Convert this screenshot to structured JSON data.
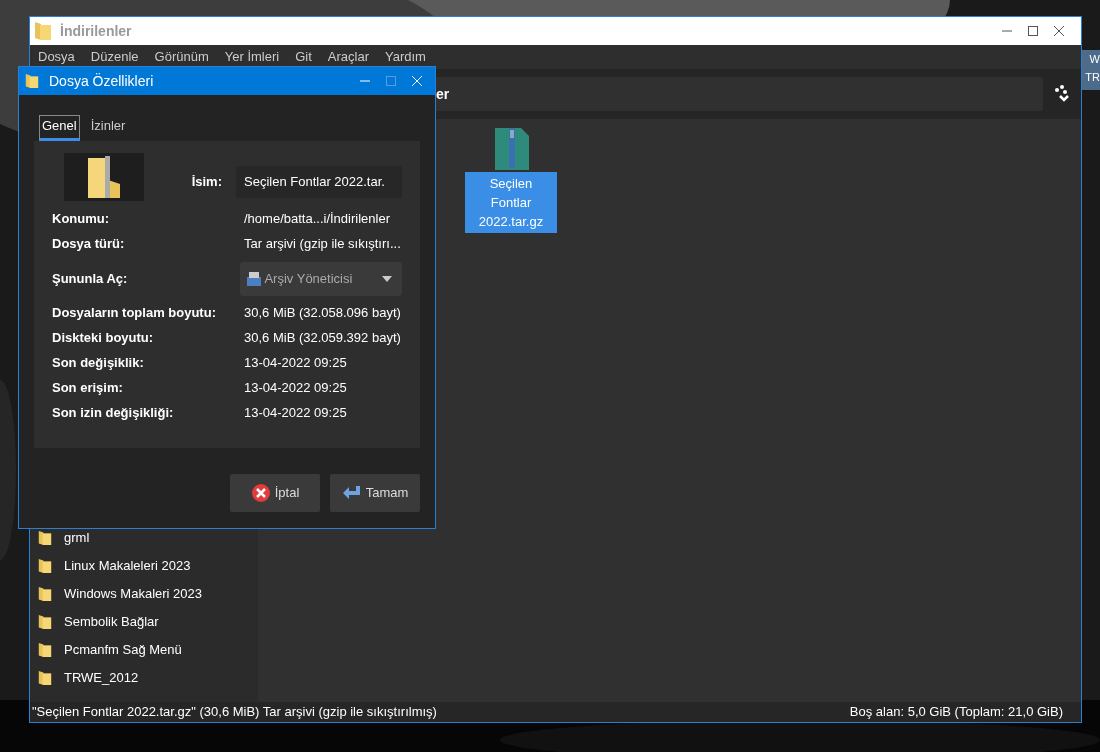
{
  "desktop": {
    "icon_labels": [
      "W",
      "TR"
    ]
  },
  "window": {
    "title": "İndirilenler",
    "menu": [
      "Dosya",
      "Düzenle",
      "Görünüm",
      "Yer İmleri",
      "Git",
      "Araçlar",
      "Yardım"
    ],
    "path": "er",
    "sidebar": {
      "items": [
        {
          "label": "grml"
        },
        {
          "label": "Linux Makaleleri 2023"
        },
        {
          "label": "Windows Makaleri 2023"
        },
        {
          "label": "Sembolik Bağlar"
        },
        {
          "label": "Pcmanfm Sağ Menü"
        },
        {
          "label": "TRWE_2012"
        }
      ]
    },
    "files": [
      {
        "name": "Seçilen Fontlar 2022.tar.gz",
        "selected": true
      }
    ],
    "status_bar": {
      "left": "\"Seçilen Fontlar 2022.tar.gz\" (30,6 MiB) Tar arşivi (gzip ile sıkıştırılmış)",
      "right": "Boş alan: 5,0 GiB (Toplam: 21,0 GiB)"
    }
  },
  "dialog": {
    "title": "Dosya Özellikleri",
    "tabs": [
      {
        "label": "Genel",
        "selected": true
      },
      {
        "label": "İzinler",
        "selected": false
      }
    ],
    "name_label": "İsim:",
    "name_value": "Seçilen Fontlar 2022.tar.",
    "rows": [
      {
        "kind": "text",
        "label": "Konumu:",
        "value": "/home/batta...i/İndirilenler"
      },
      {
        "kind": "text",
        "label": "Dosya türü:",
        "value": "Tar arşivi (gzip ile sıkıştırı..."
      },
      {
        "kind": "dropdown",
        "label": "Şununla Aç:",
        "value": "Arşiv Yöneticisi"
      },
      {
        "kind": "text",
        "label": "Dosyaların toplam boyutu:",
        "value": "30,6 MiB (32.058.096 bayt)"
      },
      {
        "kind": "text",
        "label": "Diskteki boyutu:",
        "value": "30,6 MiB (32.059.392 bayt)"
      },
      {
        "kind": "text",
        "label": "Son değişiklik:",
        "value": "13-04-2022 09:25"
      },
      {
        "kind": "text",
        "label": "Son erişim:",
        "value": "13-04-2022 09:25"
      },
      {
        "kind": "text",
        "label": "Son izin değişikliği:",
        "value": "13-04-2022 09:25"
      }
    ],
    "buttons": [
      {
        "kind": "cancel",
        "label": "İptal"
      },
      {
        "kind": "ok",
        "label": "Tamam"
      }
    ]
  }
}
